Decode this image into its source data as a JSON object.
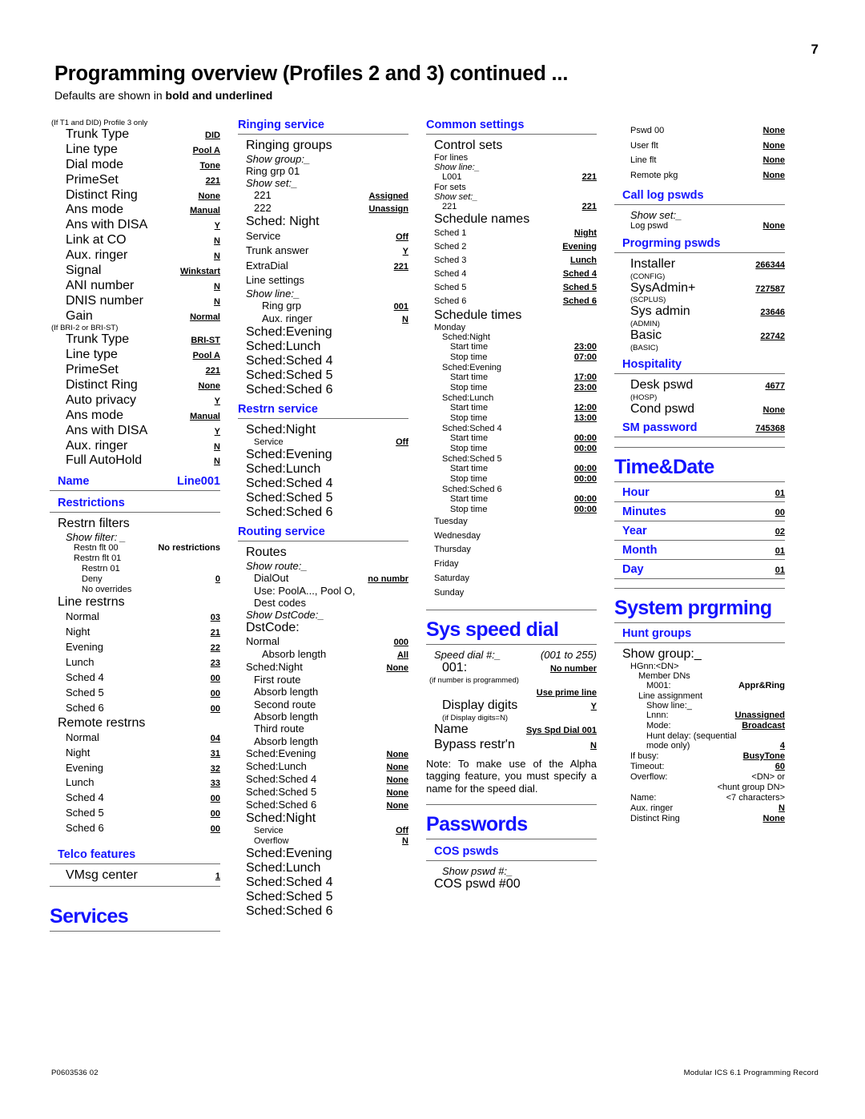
{
  "page": {
    "number": "7",
    "title": "Programming overview (Profiles 2 and 3) continued ...",
    "subtitle_prefix": "Defaults are shown in ",
    "subtitle_bold": "bold and underlined",
    "footer_left": "P0603536  02",
    "footer_right": "Modular ICS 6.1 Programming Record",
    "accent_blue": "#1414ff",
    "rule_gray": "#6b6b6b"
  },
  "col1": {
    "t1_note": "(If T1 and DID) Profile 3 only",
    "t1_rows": [
      {
        "label": "Trunk Type",
        "value": "DID"
      },
      {
        "label": "Line type",
        "value": "Pool A"
      },
      {
        "label": "Dial mode",
        "value": "Tone"
      },
      {
        "label": "PrimeSet",
        "value": "221"
      },
      {
        "label": "Distinct Ring",
        "value": "None"
      },
      {
        "label": "Ans mode",
        "value": "Manual"
      },
      {
        "label": "Ans with DISA",
        "value": "Y"
      },
      {
        "label": "Link at CO",
        "value": "N"
      },
      {
        "label": "Aux. ringer",
        "value": "N"
      },
      {
        "label": "Signal",
        "value": "Winkstart"
      },
      {
        "label": "ANI number",
        "value": "N"
      },
      {
        "label": "DNIS number",
        "value": "N"
      },
      {
        "label": "Gain",
        "value": "Normal"
      }
    ],
    "bri_note": "(If BRI-2 or BRI-ST)",
    "bri_rows": [
      {
        "label": "Trunk Type",
        "value": "BRI-ST"
      },
      {
        "label": "Line type",
        "value": "Pool A"
      },
      {
        "label": "PrimeSet",
        "value": "221"
      },
      {
        "label": "Distinct Ring",
        "value": "None"
      },
      {
        "label": "Auto privacy",
        "value": "Y"
      },
      {
        "label": "Ans mode",
        "value": "Manual"
      },
      {
        "label": "Ans with DISA",
        "value": "Y"
      },
      {
        "label": "Aux. ringer",
        "value": "N"
      },
      {
        "label": "Full AutoHold",
        "value": "N"
      }
    ],
    "name_heading": "Name",
    "name_value": "Line001",
    "restrictions_heading": "Restrictions",
    "restrn_filters_heading": "Restrn filters",
    "show_filter": "Show filter: _",
    "filter_rows": [
      {
        "label": "Restn flt 00",
        "value": "No restrictions",
        "indent": 2,
        "size": "s-small",
        "valstyle": "b"
      },
      {
        "label": "Restrn flt 01",
        "value": "",
        "indent": 2,
        "size": "s-small",
        "valstyle": ""
      },
      {
        "label": "Restrn 01",
        "value": "",
        "indent": 3,
        "size": "s-small",
        "valstyle": ""
      },
      {
        "label": "Deny",
        "value": "0",
        "indent": 3,
        "size": "s-small",
        "valstyle": "bu"
      },
      {
        "label": "No overrides",
        "value": "",
        "indent": 3,
        "size": "s-small",
        "valstyle": ""
      }
    ],
    "line_restrns_heading": "Line restrns",
    "line_restrns": [
      {
        "label": "Normal",
        "value": "03"
      },
      {
        "label": "Night",
        "value": "21"
      },
      {
        "label": "Evening",
        "value": "22"
      },
      {
        "label": "Lunch",
        "value": "23"
      },
      {
        "label": "Sched 4",
        "value": "00"
      },
      {
        "label": "Sched 5",
        "value": "00"
      },
      {
        "label": "Sched 6",
        "value": "00"
      }
    ],
    "remote_restrns_heading": "Remote restrns",
    "remote_restrns": [
      {
        "label": "Normal",
        "value": "04"
      },
      {
        "label": "Night",
        "value": "31"
      },
      {
        "label": "Evening",
        "value": "32"
      },
      {
        "label": "Lunch",
        "value": "33"
      },
      {
        "label": "Sched 4",
        "value": "00"
      },
      {
        "label": "Sched 5",
        "value": "00"
      },
      {
        "label": "Sched 6",
        "value": "00"
      }
    ],
    "telco_heading": "Telco features",
    "vmsg_label": "VMsg center",
    "vmsg_value": "1",
    "services_heading": "Services"
  },
  "col2": {
    "ringing_heading": "Ringing service",
    "ringing_groups_heading": "Ringing groups",
    "show_group": "Show group:_",
    "ring_grp_01": "Ring grp 01",
    "show_set": "Show set:_",
    "sets": [
      {
        "label": "221",
        "value": "Assigned"
      },
      {
        "label": "222",
        "value": "Unassign"
      }
    ],
    "sched_night_heading": "Sched: Night",
    "sched_night_rows": [
      {
        "label": "Service",
        "value": "Off"
      },
      {
        "label": "Trunk answer",
        "value": "Y"
      },
      {
        "label": "ExtraDial",
        "value": "221"
      },
      {
        "label": "Line settings",
        "value": ""
      }
    ],
    "show_line": "Show line:_",
    "line_rows": [
      {
        "label": "Ring grp",
        "value": "001"
      },
      {
        "label": "Aux. ringer",
        "value": "N"
      }
    ],
    "ringing_scheds": [
      "Sched:Evening",
      "Sched:Lunch",
      "Sched:Sched 4",
      "Sched:Sched 5",
      "Sched:Sched 6"
    ],
    "restrn_heading": "Restrn service",
    "restrn_sched_night": "Sched:Night",
    "restrn_service_label": "Service",
    "restrn_service_value": "Off",
    "restrn_scheds": [
      "Sched:Evening",
      "Sched:Lunch",
      "Sched:Sched 4",
      "Sched:Sched 5",
      "Sched:Sched 6"
    ],
    "routing_heading": "Routing service",
    "routes_heading": "Routes",
    "show_route": "Show route:_",
    "dialout_label": "DialOut",
    "dialout_value": "no numbr",
    "use_pools": "Use: PoolA..., Pool O,",
    "dest_codes": "Dest codes",
    "show_dstcode": "Show DstCode:_",
    "dstcode_heading": "DstCode:",
    "dst_rows": [
      {
        "label": "Normal",
        "value": "000",
        "indent": 1
      },
      {
        "label": "Absorb length",
        "value": "All",
        "indent": 2
      },
      {
        "label": "Sched:Night",
        "value": "None",
        "indent": 1
      },
      {
        "label": "First route",
        "value": "",
        "indent": 2
      },
      {
        "label": "Absorb length",
        "value": "",
        "indent": 2
      },
      {
        "label": "Second route",
        "value": "",
        "indent": 2
      },
      {
        "label": "Absorb length",
        "value": "",
        "indent": 2
      },
      {
        "label": "Third route",
        "value": "",
        "indent": 2
      },
      {
        "label": "Absorb length",
        "value": "",
        "indent": 2
      },
      {
        "label": "Sched:Evening",
        "value": "None",
        "indent": 1
      },
      {
        "label": "Sched:Lunch",
        "value": "None",
        "indent": 1
      },
      {
        "label": "Sched:Sched 4",
        "value": "None",
        "indent": 1
      },
      {
        "label": "Sched:Sched 5",
        "value": "None",
        "indent": 1
      },
      {
        "label": "Sched:Sched 6",
        "value": "None",
        "indent": 1
      }
    ],
    "routing_sched_night": "Sched:Night",
    "routing_service_label": "Service",
    "routing_service_value": "Off",
    "routing_overflow_label": "Overflow",
    "routing_overflow_value": "N",
    "routing_scheds": [
      "Sched:Evening",
      "Sched:Lunch",
      "Sched:Sched 4",
      "Sched:Sched 5",
      "Sched:Sched 6"
    ]
  },
  "col3": {
    "common_heading": "Common settings",
    "control_sets_heading": "Control sets",
    "for_lines": "For lines",
    "show_line": "Show line:_",
    "l001_label": "L001",
    "l001_value": "221",
    "for_sets": "For sets",
    "show_set": "Show set:_",
    "set221_label": "221",
    "set221_value": "221",
    "schedule_names_heading": "Schedule names",
    "schedule_names": [
      {
        "label": "Sched 1",
        "value": "Night"
      },
      {
        "label": "Sched 2",
        "value": "Evening"
      },
      {
        "label": "Sched 3",
        "value": "Lunch"
      },
      {
        "label": "Sched 4",
        "value": "Sched 4"
      },
      {
        "label": "Sched 5",
        "value": "Sched 5"
      },
      {
        "label": "Sched 6",
        "value": "Sched 6"
      }
    ],
    "schedule_times_heading": "Schedule times",
    "monday": "Monday",
    "monday_blocks": [
      {
        "name": "Sched:Night",
        "start": "23:00",
        "stop": "07:00"
      },
      {
        "name": "Sched:Evening",
        "start": "17:00",
        "stop": "23:00"
      },
      {
        "name": "Sched:Lunch",
        "start": "12:00",
        "stop": "13:00"
      },
      {
        "name": "Sched:Sched 4",
        "start": "00:00",
        "stop": "00:00"
      },
      {
        "name": "Sched:Sched 5",
        "start": "00:00",
        "stop": "00:00"
      },
      {
        "name": "Sched:Sched 6",
        "start": "00:00",
        "stop": "00:00"
      }
    ],
    "start_label": "Start time",
    "stop_label": "Stop time",
    "other_days": [
      "Tuesday",
      "Wednesday",
      "Thursday",
      "Friday",
      "Saturday",
      "Sunday"
    ],
    "sys_speed_heading": "Sys speed dial",
    "speed_dial_label": "Speed dial #:_",
    "speed_dial_range": "(001 to 255)",
    "speed_001_label": "001:",
    "speed_001_value": "No number",
    "if_programmed": "(if number is programmed)",
    "use_prime_line": "Use prime line",
    "display_digits_label": "Display digits",
    "display_digits_value": "Y",
    "if_display_digits": "(if Display digits=N)",
    "name_label": "Name",
    "name_value": "Sys Spd Dial 001",
    "bypass_label": "Bypass restr'n",
    "bypass_value": "N",
    "note": "Note: To make use of the Alpha tagging feature, you must specify a name for the speed dial.",
    "passwords_heading": "Passwords",
    "cos_heading": "COS pswds",
    "show_pswd": "Show pswd #:_",
    "cos_pswd_00": "COS pswd #00"
  },
  "col4": {
    "pswd_rows": [
      {
        "label": "Pswd 00",
        "value": "None"
      },
      {
        "label": "User flt",
        "value": "None"
      },
      {
        "label": "Line flt",
        "value": "None"
      },
      {
        "label": "Remote pkg",
        "value": "None"
      }
    ],
    "call_log_heading": "Call log pswds",
    "show_set": "Show set:_",
    "log_pswd_label": "Log pswd",
    "log_pswd_value": "None",
    "progrming_heading": "Progrming pswds",
    "prog_rows": [
      {
        "label": "Installer",
        "value": "266344",
        "sub": "(CONFIG)"
      },
      {
        "label": "SysAdmin+",
        "value": "727587",
        "sub": "(SCPLUS)"
      },
      {
        "label": "Sys admin",
        "value": "23646",
        "sub": "(ADMIN)"
      },
      {
        "label": "Basic",
        "value": "22742",
        "sub": "(BASIC)"
      }
    ],
    "hospitality_heading": "Hospitality",
    "desk_pswd_label": "Desk pswd",
    "desk_pswd_value": "4677",
    "hosp_sub": "(HOSP)",
    "cond_pswd_label": "Cond pswd",
    "cond_pswd_value": "None",
    "sm_password_label": "SM password",
    "sm_password_value": "745368",
    "time_date_heading": "Time&Date",
    "time_date_rows": [
      {
        "label": "Hour",
        "value": "01"
      },
      {
        "label": "Minutes",
        "value": "00"
      },
      {
        "label": "Year",
        "value": "02"
      },
      {
        "label": "Month",
        "value": "01"
      },
      {
        "label": "Day",
        "value": "01"
      }
    ],
    "system_prgrming_heading": "System prgrming",
    "hunt_groups_heading": "Hunt groups",
    "show_group": "Show group:_",
    "hgnn": "HGnn:<DN>",
    "member_dns": "Member DNs",
    "m001_label": "M001:",
    "m001_value": "Appr&Ring",
    "line_assignment": "Line assignment",
    "show_line": "Show line:_",
    "lnnn_label": "Lnnn:",
    "lnnn_value": "Unassigned",
    "mode_label": "Mode:",
    "mode_value": "Broadcast",
    "hunt_delay_1": "Hunt delay: (sequential",
    "hunt_delay_2": "mode only)",
    "hunt_delay_value": "4",
    "if_busy_label": "If busy:",
    "if_busy_value": "BusyTone",
    "timeout_label": "Timeout:",
    "timeout_value": "60",
    "overflow_label": "Overflow:",
    "overflow_value_1": "<DN> or",
    "overflow_value_2": "<hunt group DN>",
    "hg_name_label": "Name:",
    "hg_name_value": "<7 characters>",
    "aux_ringer_label": "Aux. ringer",
    "aux_ringer_value": "N",
    "distinct_ring_label": "Distinct Ring",
    "distinct_ring_value": "None"
  }
}
